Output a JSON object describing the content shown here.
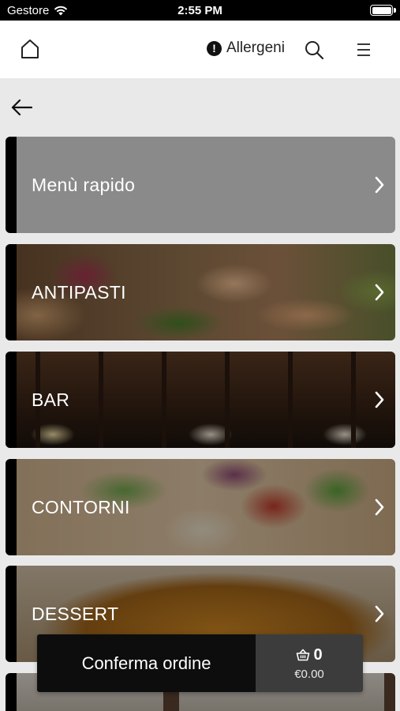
{
  "status_bar": {
    "carrier": "Gestore",
    "time": "2:55 PM"
  },
  "header": {
    "allergens_label": "Allergeni"
  },
  "categories": [
    {
      "label": "Menù rapido"
    },
    {
      "label": "ANTIPASTI"
    },
    {
      "label": "BAR"
    },
    {
      "label": "CONTORNI"
    },
    {
      "label": "DESSERT"
    },
    {
      "label": ""
    }
  ],
  "order": {
    "confirm_label": "Conferma ordine",
    "cart_count": "0",
    "cart_total": "€0.00"
  },
  "icons": {
    "home": "home-icon",
    "allergens": "exclamation-icon",
    "search": "search-icon",
    "menu": "hamburger-icon",
    "back": "arrow-left-icon",
    "chevron": "chevron-right-icon",
    "cart": "basket-icon"
  },
  "colors": {
    "header_bg": "#ffffff",
    "page_bg": "#e9e9e9",
    "stripe": "#000000",
    "order_dark": "#0d0d0d",
    "order_cart": "#3c3c3c"
  }
}
